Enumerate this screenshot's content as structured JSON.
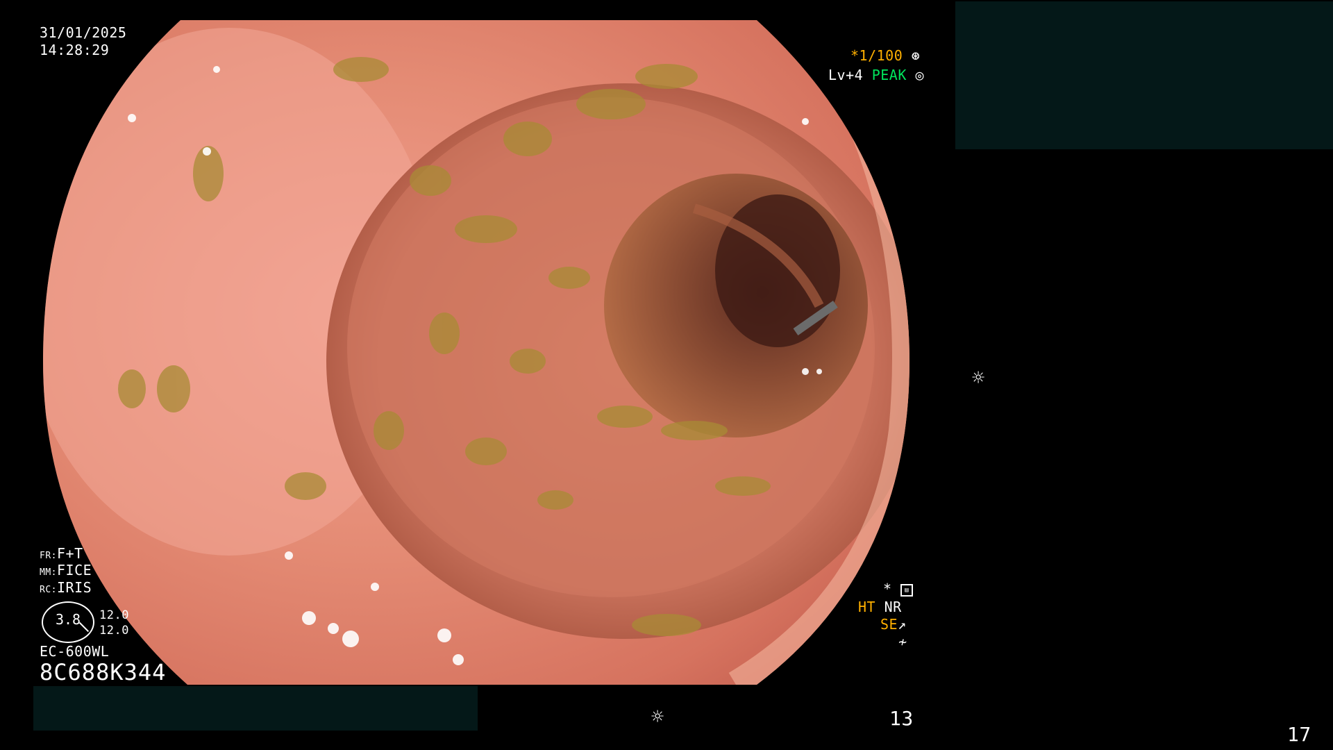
{
  "colors": {
    "background": "#000000",
    "mucosa": "#e28a72",
    "debris": "#a58a2e",
    "redaction": "#041818",
    "accent_orange": "#ffb000",
    "accent_green": "#00e65c"
  },
  "overlay": {
    "date": "31/01/2025",
    "time": "14:28:29",
    "shutter": "*1/100",
    "light_level": "Lv+4",
    "light_mode": "PEAK",
    "fr": "FR:",
    "fr_value": "F+T",
    "mm": "MM:",
    "mm_value": "FICE",
    "rc": "RC:",
    "rc_value": "IRIS",
    "iris_value": "3.8",
    "iris_scale_top": "12.0",
    "iris_scale_bottom": "12.0",
    "scope_model": "EC-600WL",
    "scope_serial": "8C688K344",
    "ht": "HT",
    "nr": "NR",
    "se": "SE",
    "frame_left": "13",
    "frame_right": "17"
  },
  "icons": {
    "shutter_icon": "aperture-icon",
    "peak_icon": "ring-icon",
    "brightness_icons": "sun-icon",
    "freeze_icon": "freeze-icon",
    "record_icon": "record-icon"
  }
}
